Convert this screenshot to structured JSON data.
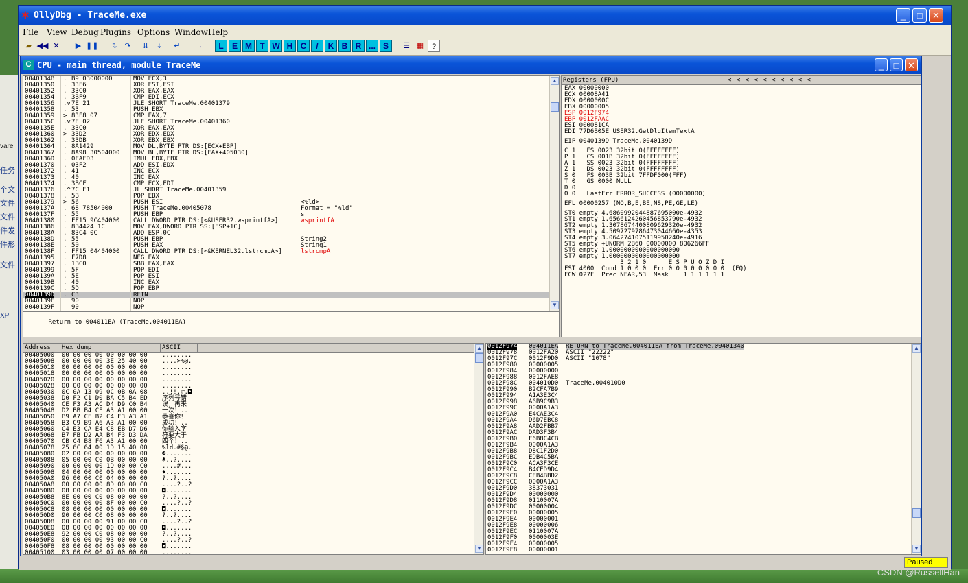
{
  "app": {
    "title": "OllyDbg - TraceMe.exe"
  },
  "desktop": {
    "items": [
      "任务",
      "个文",
      "文件",
      "文件",
      "件发",
      "件形",
      "文件"
    ],
    "left_text_1": "vare",
    "left_text_2": "XP",
    "watermark": "CSDN @RussellHan"
  },
  "menu": [
    "File",
    "View",
    "Debug",
    "Plugins",
    "Options",
    "Window",
    "Help"
  ],
  "toolbar": {
    "letters": [
      "L",
      "E",
      "M",
      "T",
      "W",
      "H",
      "C",
      "/",
      "K",
      "B",
      "R",
      "...",
      "S"
    ],
    "help": "?"
  },
  "cpu_window": {
    "title": "CPU - main thread, module TraceMe"
  },
  "disasm": {
    "rows": [
      [
        "0040134B",
        ".",
        "B9 03000000",
        "MOV ECX,3",
        "",
        ""
      ],
      [
        "00401350",
        ".",
        "33F6",
        "XOR ESI,ESI",
        "",
        ""
      ],
      [
        "00401352",
        ".",
        "33C0",
        "XOR EAX,EAX",
        "",
        ""
      ],
      [
        "00401354",
        ".",
        "3BF9",
        "CMP EDI,ECX",
        "",
        ""
      ],
      [
        "00401356",
        ".v",
        "7E 21",
        "JLE SHORT TraceMe.00401379",
        "",
        ""
      ],
      [
        "00401358",
        ".",
        "53",
        "PUSH EBX",
        "",
        ""
      ],
      [
        "00401359",
        ">",
        "83F8 07",
        "CMP EAX,7",
        "",
        ""
      ],
      [
        "0040135C",
        ".v",
        "7E 02",
        "JLE SHORT TraceMe.00401360",
        "",
        ""
      ],
      [
        "0040135E",
        ".",
        "33C0",
        "XOR EAX,EAX",
        "",
        ""
      ],
      [
        "00401360",
        ">",
        "33D2",
        "XOR EDX,EDX",
        "",
        ""
      ],
      [
        "00401362",
        ".",
        "33DB",
        "XOR EBX,EBX",
        "",
        ""
      ],
      [
        "00401364",
        ".",
        "8A1429",
        "MOV DL,BYTE PTR DS:[ECX+EBP]",
        "",
        ""
      ],
      [
        "00401367",
        ".",
        "8A98 30504000",
        "MOV BL,BYTE PTR DS:[EAX+405030]",
        "",
        ""
      ],
      [
        "0040136D",
        ".",
        "0FAFD3",
        "IMUL EDX,EBX",
        "",
        ""
      ],
      [
        "00401370",
        ".",
        "03F2",
        "ADD ESI,EDX",
        "",
        ""
      ],
      [
        "00401372",
        ".",
        "41",
        "INC ECX",
        "",
        ""
      ],
      [
        "00401373",
        ".",
        "40",
        "INC EAX",
        "",
        ""
      ],
      [
        "00401374",
        ".",
        "3BCF",
        "CMP ECX,EDI",
        "",
        ""
      ],
      [
        "00401376",
        ".^",
        "7C E1",
        "JL SHORT TraceMe.00401359",
        "",
        ""
      ],
      [
        "00401378",
        ".",
        "5B",
        "POP EBX",
        "",
        ""
      ],
      [
        "00401379",
        ">",
        "56",
        "PUSH ESI",
        "<%ld>",
        ""
      ],
      [
        "0040137A",
        ".",
        "68 78504000",
        "PUSH TraceMe.00405078",
        "Format = \"%ld\"",
        ""
      ],
      [
        "0040137F",
        ".",
        "55",
        "PUSH EBP",
        "s",
        ""
      ],
      [
        "00401380",
        ".",
        "FF15 9C404000",
        "CALL DWORD PTR DS:[<&USER32.wsprintfA>]",
        "wsprintfA",
        "red"
      ],
      [
        "00401386",
        ".",
        "8B4424 1C",
        "MOV EAX,DWORD PTR SS:[ESP+1C]",
        "",
        ""
      ],
      [
        "0040138A",
        ".",
        "83C4 0C",
        "ADD ESP,0C",
        "",
        ""
      ],
      [
        "0040138D",
        ".",
        "55",
        "PUSH EBP",
        "String2",
        ""
      ],
      [
        "0040138E",
        ".",
        "50",
        "PUSH EAX",
        "String1",
        ""
      ],
      [
        "0040138F",
        ".",
        "FF15 04404000",
        "CALL DWORD PTR DS:[<&KERNEL32.lstrcmpA>]",
        "lstrcmpA",
        "red"
      ],
      [
        "00401395",
        ".",
        "F7D8",
        "NEG EAX",
        "",
        ""
      ],
      [
        "00401397",
        ".",
        "1BC0",
        "SBB EAX,EAX",
        "",
        ""
      ],
      [
        "00401399",
        ".",
        "5F",
        "POP EDI",
        "",
        ""
      ],
      [
        "0040139A",
        ".",
        "5E",
        "POP ESI",
        "",
        ""
      ],
      [
        "0040139B",
        ".",
        "40",
        "INC EAX",
        "",
        ""
      ],
      [
        "0040139C",
        ".",
        "5D",
        "POP EBP",
        "",
        ""
      ],
      [
        "0040139D",
        ".",
        "C3",
        "RETN",
        "",
        "sel"
      ],
      [
        "0040139E",
        "",
        "90",
        "NOP",
        "",
        ""
      ],
      [
        "0040139F",
        "",
        "90",
        "NOP",
        "",
        ""
      ]
    ],
    "info": "Return to 004011EA (TraceMe.004011EA)"
  },
  "registers": {
    "header": "Registers (FPU)",
    "arrows": "<   <   <   <   <   <   <   <   <   <",
    "lines": [
      {
        "t": "EAX 00000000",
        "c": ""
      },
      {
        "t": "ECX 00008A41",
        "c": ""
      },
      {
        "t": "EDX 0000000C",
        "c": ""
      },
      {
        "t": "EBX 00000005",
        "c": ""
      },
      {
        "t": "ESP 0012F974",
        "c": "red"
      },
      {
        "t": "EBP 0012FAAC",
        "c": "red"
      },
      {
        "t": "ESI 000081CA",
        "c": ""
      },
      {
        "t": "EDI 77D6B05E USER32.GetDlgItemTextA",
        "c": ""
      },
      {
        "t": "",
        "c": ""
      },
      {
        "t": "EIP 0040139D TraceMe.0040139D",
        "c": ""
      },
      {
        "t": "",
        "c": ""
      },
      {
        "t": "C 1   ES 0023 32bit 0(FFFFFFFF)",
        "c": ""
      },
      {
        "t": "P 1   CS 001B 32bit 0(FFFFFFFF)",
        "c": ""
      },
      {
        "t": "A 1   SS 0023 32bit 0(FFFFFFFF)",
        "c": ""
      },
      {
        "t": "Z 1   DS 0023 32bit 0(FFFFFFFF)",
        "c": ""
      },
      {
        "t": "S 0   FS 003B 32bit 7FFDF000(FFF)",
        "c": ""
      },
      {
        "t": "T 0   GS 0000 NULL",
        "c": ""
      },
      {
        "t": "D 0",
        "c": ""
      },
      {
        "t": "O 0   LastErr ERROR_SUCCESS (00000000)",
        "c": ""
      },
      {
        "t": "",
        "c": ""
      },
      {
        "t": "EFL 00000257 (NO,B,E,BE,NS,PE,GE,LE)",
        "c": ""
      },
      {
        "t": "",
        "c": ""
      },
      {
        "t": "ST0 empty 4.6860992044887695000e-4932",
        "c": ""
      },
      {
        "t": "ST1 empty 1.6566124260456853790e-4932",
        "c": ""
      },
      {
        "t": "ST2 empty 1.3078674400809629320e-4932",
        "c": ""
      },
      {
        "t": "ST3 empty 4.5097279786473044660e-4353",
        "c": ""
      },
      {
        "t": "ST4 empty 3.0642741075119950240e-4916",
        "c": ""
      },
      {
        "t": "ST5 empty +UNORM 2B60 00000000 806266FF",
        "c": ""
      },
      {
        "t": "ST6 empty 1.0000000000000000000",
        "c": ""
      },
      {
        "t": "ST7 empty 1.0000000000000000000",
        "c": ""
      },
      {
        "t": "               3 2 1 0      E S P U O Z D I",
        "c": ""
      },
      {
        "t": "FST 4000  Cond 1 0 0 0  Err 0 0 0 0 0 0 0 0  (EQ)",
        "c": ""
      },
      {
        "t": "FCW 027F  Prec NEAR,53  Mask    1 1 1 1 1 1",
        "c": ""
      }
    ]
  },
  "dump": {
    "headers": [
      "Address",
      "Hex dump",
      "ASCII"
    ],
    "rows": [
      [
        "00405000",
        "00 00 00 00 00 00 00 00",
        "........"
      ],
      [
        "00405008",
        "00 00 00 00 3E 25 40 00",
        "....>%@."
      ],
      [
        "00405010",
        "00 00 00 00 00 00 00 00",
        "........"
      ],
      [
        "00405018",
        "00 00 00 00 00 00 00 00",
        "........"
      ],
      [
        "00405020",
        "00 00 00 00 00 00 00 00",
        "........"
      ],
      [
        "00405028",
        "00 00 00 00 00 00 00 00",
        "........"
      ],
      [
        "00405030",
        "0C 0A 13 09 0C 0B 0A 08",
        "..!!.♂.◘"
      ],
      [
        "00405038",
        "D0 F2 C1 D0 BA C5 B4 ED",
        "序列号错"
      ],
      [
        "00405040",
        "CE F3 A3 AC D4 D9 C0 B4",
        "误，再来"
      ],
      [
        "00405048",
        "D2 BB B4 CE A3 A1 00 00",
        "一次！.."
      ],
      [
        "00405050",
        "B9 A7 CF B2 C4 E3 A3 A1",
        "恭喜你！"
      ],
      [
        "00405058",
        "B3 C9 B9 A6 A3 A1 00 00",
        "成功！.."
      ],
      [
        "00405060",
        "C4 E3 CA E4 C8 EB D7 D6",
        "你输入字"
      ],
      [
        "00405068",
        "B7 FB D2 AA B4 F3 D3 DA",
        "符要大于"
      ],
      [
        "00405070",
        "CB C4 B8 F6 A3 A1 00 00",
        "四个！.."
      ],
      [
        "00405078",
        "25 6C 64 00 1D 15 40 00",
        "%ld.#§@."
      ],
      [
        "00405080",
        "02 00 00 00 00 00 00 00",
        "☻......."
      ],
      [
        "00405088",
        "05 00 00 C0 0B 00 00 00",
        "♣..?...."
      ],
      [
        "00405090",
        "00 00 00 00 1D 00 00 C0",
        "....#..."
      ],
      [
        "00405098",
        "04 00 00 00 00 00 00 00",
        "♦......."
      ],
      [
        "004050A0",
        "96 00 00 C0 04 00 00 00",
        "?..?...."
      ],
      [
        "004050A8",
        "00 00 00 00 8D 00 00 C0",
        "....?..?"
      ],
      [
        "004050B0",
        "08 00 00 00 00 00 00 00",
        "◘......."
      ],
      [
        "004050B8",
        "8E 00 00 C0 08 00 00 00",
        "?..?...."
      ],
      [
        "004050C0",
        "00 00 00 00 8F 00 00 C0",
        "....?..?"
      ],
      [
        "004050C8",
        "08 00 00 00 00 00 00 00",
        "◘......."
      ],
      [
        "004050D0",
        "90 00 00 C0 08 00 00 00",
        "?..?...."
      ],
      [
        "004050D8",
        "00 00 00 00 91 00 00 C0",
        "....?..?"
      ],
      [
        "004050E0",
        "08 00 00 00 00 00 00 00",
        "◘......."
      ],
      [
        "004050E8",
        "92 00 00 C0 08 00 00 00",
        "?..?...."
      ],
      [
        "004050F0",
        "00 00 00 00 93 00 00 C0",
        "....?..?"
      ],
      [
        "004050F8",
        "08 00 00 00 00 00 00 00",
        "◘......."
      ],
      [
        "00405100",
        "03 00 00 00 07 00 00 00",
        "........"
      ]
    ]
  },
  "stack": {
    "rows": [
      [
        "0012F974",
        "004011EA",
        "RETURN to TraceMe.004011EA from TraceMe.00401340",
        "top"
      ],
      [
        "0012F978",
        "0012FA20",
        "ASCII \"22222\"",
        ""
      ],
      [
        "0012F97C",
        "0012F9D0",
        "ASCII \"1078\"",
        ""
      ],
      [
        "0012F980",
        "00000005",
        "",
        ""
      ],
      [
        "0012F984",
        "00000000",
        "",
        ""
      ],
      [
        "0012F988",
        "0012FAE8",
        "",
        ""
      ],
      [
        "0012F98C",
        "004010D0",
        "TraceMe.004010D0",
        ""
      ],
      [
        "0012F990",
        "B2CFA7B9",
        "",
        ""
      ],
      [
        "0012F994",
        "A1A3E3C4",
        "",
        ""
      ],
      [
        "0012F998",
        "A6B9C9B3",
        "",
        ""
      ],
      [
        "0012F99C",
        "0000A1A3",
        "",
        ""
      ],
      [
        "0012F9A0",
        "E4CAE3C4",
        "",
        ""
      ],
      [
        "0012F9A4",
        "D6D7EBC8",
        "",
        ""
      ],
      [
        "0012F9A8",
        "AAD2FBB7",
        "",
        ""
      ],
      [
        "0012F9AC",
        "DAD3F3B4",
        "",
        ""
      ],
      [
        "0012F9B0",
        "F6B8C4CB",
        "",
        ""
      ],
      [
        "0012F9B4",
        "0000A1A3",
        "",
        ""
      ],
      [
        "0012F9B8",
        "D8C1F2D0",
        "",
        ""
      ],
      [
        "0012F9BC",
        "EDB4C5BA",
        "",
        ""
      ],
      [
        "0012F9C0",
        "ACA3F3CE",
        "",
        ""
      ],
      [
        "0012F9C4",
        "B4CED9D4",
        "",
        ""
      ],
      [
        "0012F9C8",
        "CEB4BBD2",
        "",
        ""
      ],
      [
        "0012F9CC",
        "0000A1A3",
        "",
        ""
      ],
      [
        "0012F9D0",
        "38373031",
        "",
        ""
      ],
      [
        "0012F9D4",
        "00000000",
        "",
        ""
      ],
      [
        "0012F9D8",
        "0110007A",
        "",
        ""
      ],
      [
        "0012F9DC",
        "00000004",
        "",
        ""
      ],
      [
        "0012F9E0",
        "00000005",
        "",
        ""
      ],
      [
        "0012F9E4",
        "00000001",
        "",
        ""
      ],
      [
        "0012F9E8",
        "00000006",
        "",
        ""
      ],
      [
        "0012F9EC",
        "0110007A",
        "",
        ""
      ],
      [
        "0012F9F0",
        "0000003E",
        "",
        ""
      ],
      [
        "0012F9F4",
        "00000005",
        "",
        ""
      ],
      [
        "0012F9F8",
        "00000001",
        "",
        ""
      ]
    ]
  },
  "status": {
    "state": "Paused"
  },
  "colors": {
    "title_blue": "#0a54d8",
    "pane_bg": "#fffbf0",
    "highlight_red": "#e00000",
    "paused_yellow": "#ffff00",
    "toolbar_cyan": "#00c0e0"
  }
}
